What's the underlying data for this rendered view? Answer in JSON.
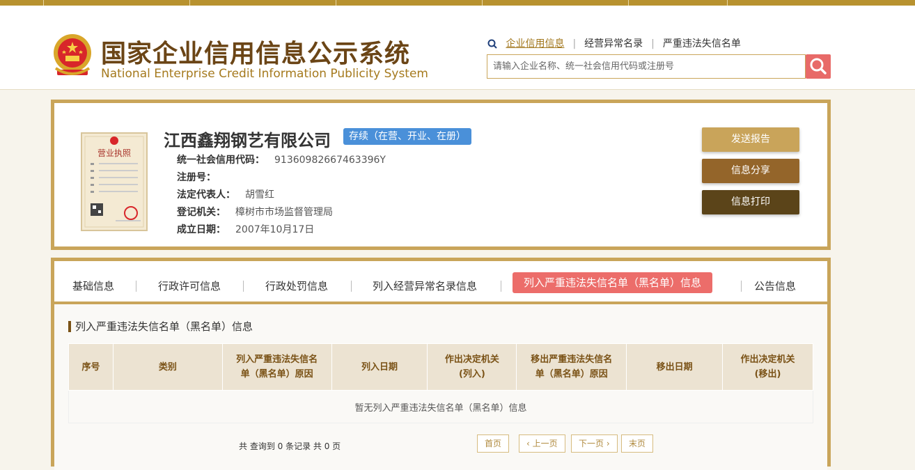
{
  "site": {
    "title_cn": "国家企业信用信息公示系统",
    "title_en": "National Enterprise Credit Information Publicity System"
  },
  "top_links": [
    "企业信用信息",
    "经营异常名录",
    "严重违法失信名单"
  ],
  "search": {
    "placeholder": "请输入企业名称、统一社会信用代码或注册号"
  },
  "company": {
    "name": "江西鑫翔钢艺有限公司",
    "status": "存续（在营、开业、在册）",
    "license_text": "营业执照",
    "fields": [
      {
        "label": "统一社会信用代码：",
        "value": "91360982667463396Y"
      },
      {
        "label": "注册号：",
        "value": ""
      },
      {
        "label": "法定代表人：",
        "value": "胡雪红"
      },
      {
        "label": "登记机关：",
        "value": "樟树市市场监督管理局"
      },
      {
        "label": "成立日期：",
        "value": "2007年10月17日"
      }
    ]
  },
  "actions": {
    "send_report": "发送报告",
    "share": "信息分享",
    "print": "信息打印"
  },
  "tabs": [
    "基础信息",
    "行政许可信息",
    "行政处罚信息",
    "列入经营异常名录信息",
    "列入严重违法失信名单（黑名单）信息",
    "公告信息"
  ],
  "section": {
    "title": "列入严重违法失信名单（黑名单）信息",
    "columns": [
      [
        "序号"
      ],
      [
        "类别"
      ],
      [
        "列入严重违法失信名",
        "单（黑名单）原因"
      ],
      [
        "列入日期"
      ],
      [
        "作出决定机关",
        "(列入)"
      ],
      [
        "移出严重违法失信名",
        "单（黑名单）原因"
      ],
      [
        "移出日期"
      ],
      [
        "作出决定机关",
        "(移出)"
      ]
    ],
    "empty_text": "暂无列入严重违法失信名单（黑名单）信息"
  },
  "pager": {
    "summary": "共 查询到 0 条记录 共 0 页",
    "first": "首页",
    "prev": "上一页",
    "next": "下一页",
    "last": "末页"
  },
  "colors": {
    "brand_gold": "#c9a55a",
    "title_brown": "#6b4516",
    "active_tab": "#ec6d6a",
    "status_badge": "#4a90d9",
    "btn_send": "#c9a45a",
    "btn_share": "#94652a",
    "btn_print": "#5b4419"
  }
}
